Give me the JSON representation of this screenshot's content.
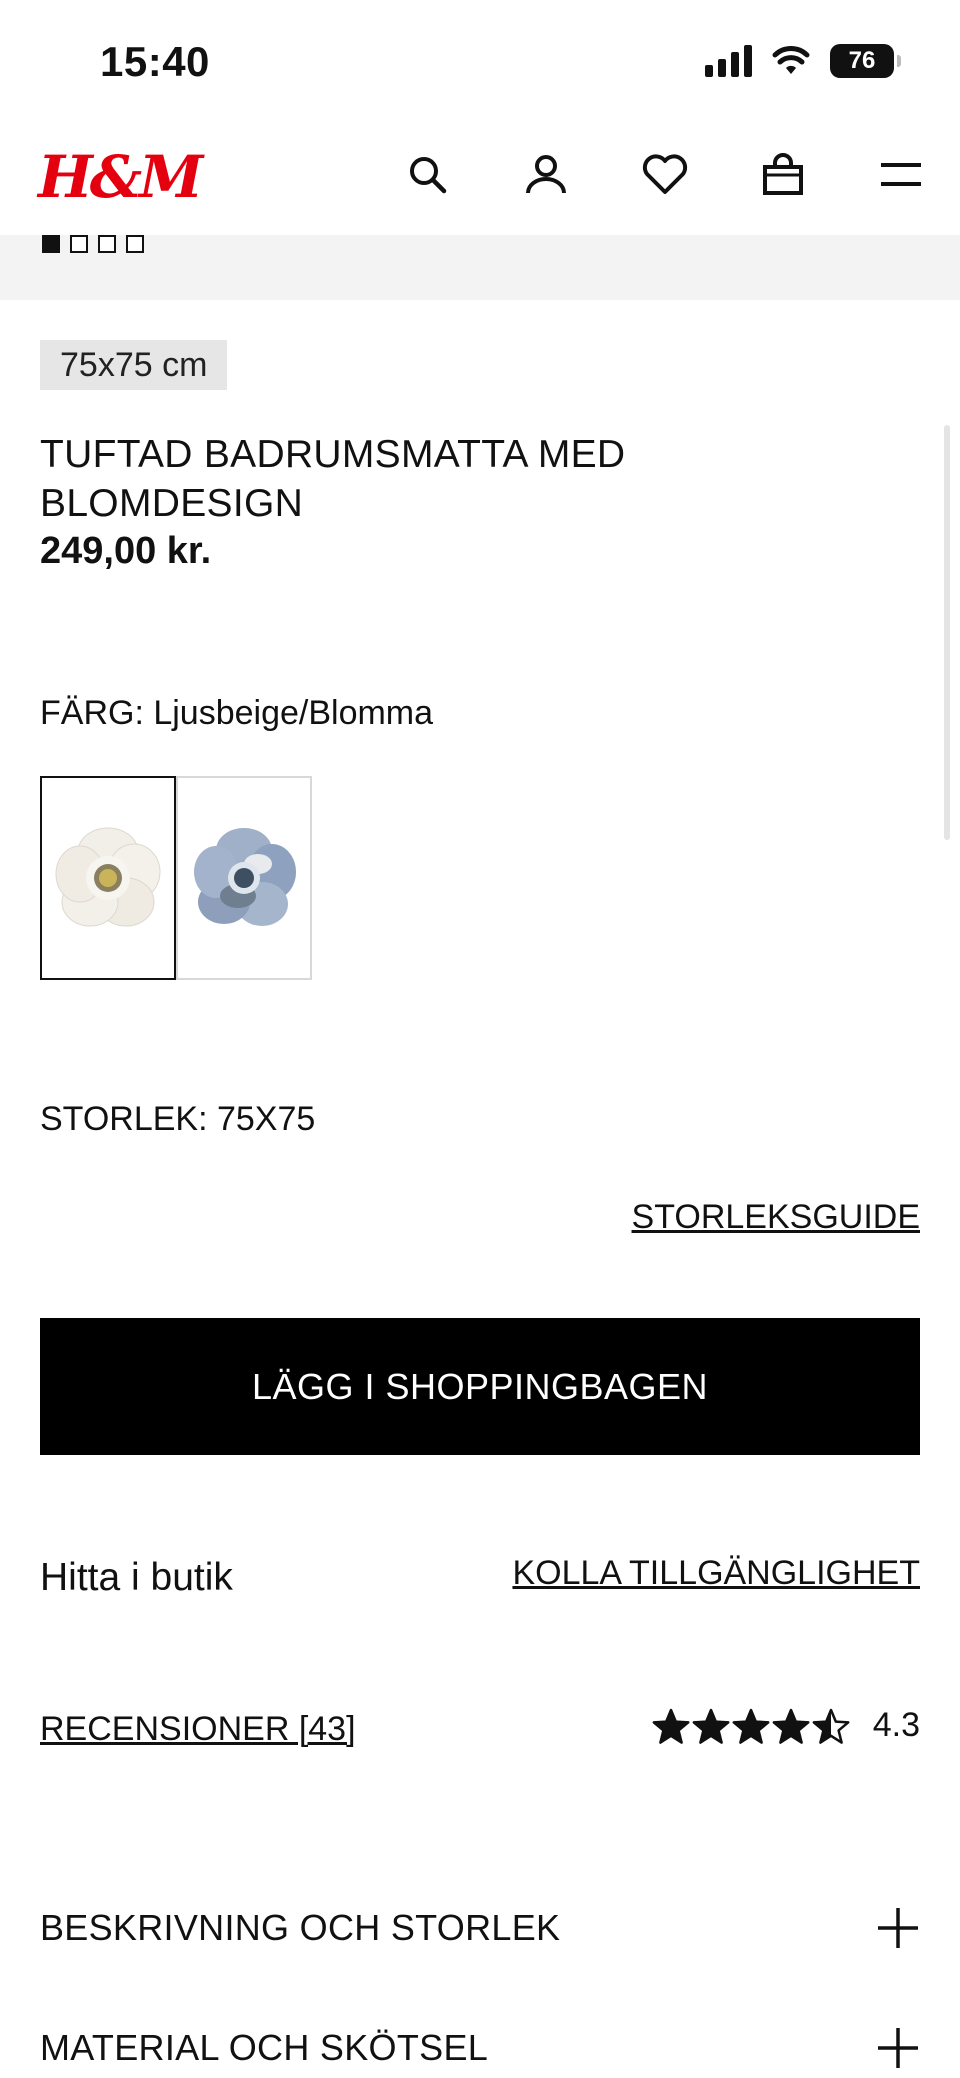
{
  "status_bar": {
    "time": "15:40",
    "battery": "76",
    "icons": [
      "signal-icon",
      "wifi-icon",
      "battery-icon"
    ]
  },
  "header": {
    "logo": "H&M",
    "brand_color": "#e50010",
    "icons": [
      "search-icon",
      "account-icon",
      "heart-icon",
      "bag-icon",
      "menu-icon"
    ]
  },
  "gallery": {
    "image_count": 4,
    "active_index": 0
  },
  "product": {
    "size_tag": "75x75 cm",
    "title": "TUFTAD BADRUMSMATTA MED BLOMDESIGN",
    "price": "249,00 kr."
  },
  "color": {
    "label": "FÄRG: Ljusbeige/Blomma",
    "swatches": [
      {
        "name": "Ljusbeige/Blomma",
        "selected": true
      },
      {
        "name": "Blå/Blomma",
        "selected": false
      }
    ]
  },
  "size": {
    "label": "STORLEK: 75X75",
    "guide_link": "STORLEKSGUIDE"
  },
  "add_to_bag": "LÄGG I SHOPPINGBAGEN",
  "store": {
    "label": "Hitta i butik",
    "link": "KOLLA TILLGÄNGLIGHET"
  },
  "reviews": {
    "link": "RECENSIONER [43]",
    "rating": "4.3",
    "stars_filled": 4.3
  },
  "accordions": [
    {
      "title": "BESKRIVNING OCH STORLEK"
    },
    {
      "title": "MATERIAL OCH SKÖTSEL"
    }
  ]
}
